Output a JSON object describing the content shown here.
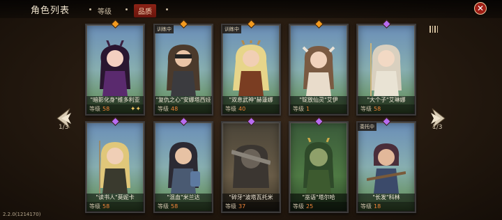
{
  "header": {
    "title": "角色列表",
    "tabs": [
      {
        "label": "等级",
        "active": false
      },
      {
        "label": "品质",
        "active": true
      }
    ],
    "close_icon": "close-icon"
  },
  "pager": {
    "left_page": "1/3",
    "right_page": "1/3"
  },
  "version": "2.2.0(1214170)",
  "level_label": "等级",
  "cards": [
    {
      "name": "\"暗影化身\"维多利亚",
      "level": "58",
      "stars": "✦✦",
      "badge": "",
      "gem": "orange"
    },
    {
      "name": "\"复仇之心\"安娜塔西娅",
      "level": "48",
      "stars": "",
      "badge": "训练中",
      "gem": "orange"
    },
    {
      "name": "\"双息武神\"赫蓮娜",
      "level": "40",
      "stars": "",
      "badge": "训练中",
      "gem": "orange"
    },
    {
      "name": "\"锭放仙灵\"艾伊",
      "level": "1",
      "stars": "",
      "badge": "",
      "gem": "orange"
    },
    {
      "name": "\"大个子\"艾琳娜",
      "level": "58",
      "stars": "",
      "badge": "",
      "gem": "purple"
    },
    {
      "name": "\"读书人\"莫妮卡",
      "level": "58",
      "stars": "",
      "badge": "",
      "gem": "purple"
    },
    {
      "name": "\"混血\"米兰达",
      "level": "58",
      "stars": "",
      "badge": "",
      "gem": "purple"
    },
    {
      "name": "\"碎牙\"波塔瓦托米",
      "level": "37",
      "stars": "",
      "badge": "",
      "gem": "purple"
    },
    {
      "name": "\"巫语\"塔尔哈",
      "level": "25",
      "stars": "",
      "badge": "",
      "gem": "purple"
    },
    {
      "name": "\"长发\"科林",
      "level": "18",
      "stars": "",
      "badge": "委托中",
      "gem": "purple"
    }
  ],
  "colors": {
    "accent_red": "#9e1d14",
    "level_orange": "#ff8c3c",
    "gem_orange": "#f29a1f",
    "gem_purple": "#b86cf0"
  }
}
